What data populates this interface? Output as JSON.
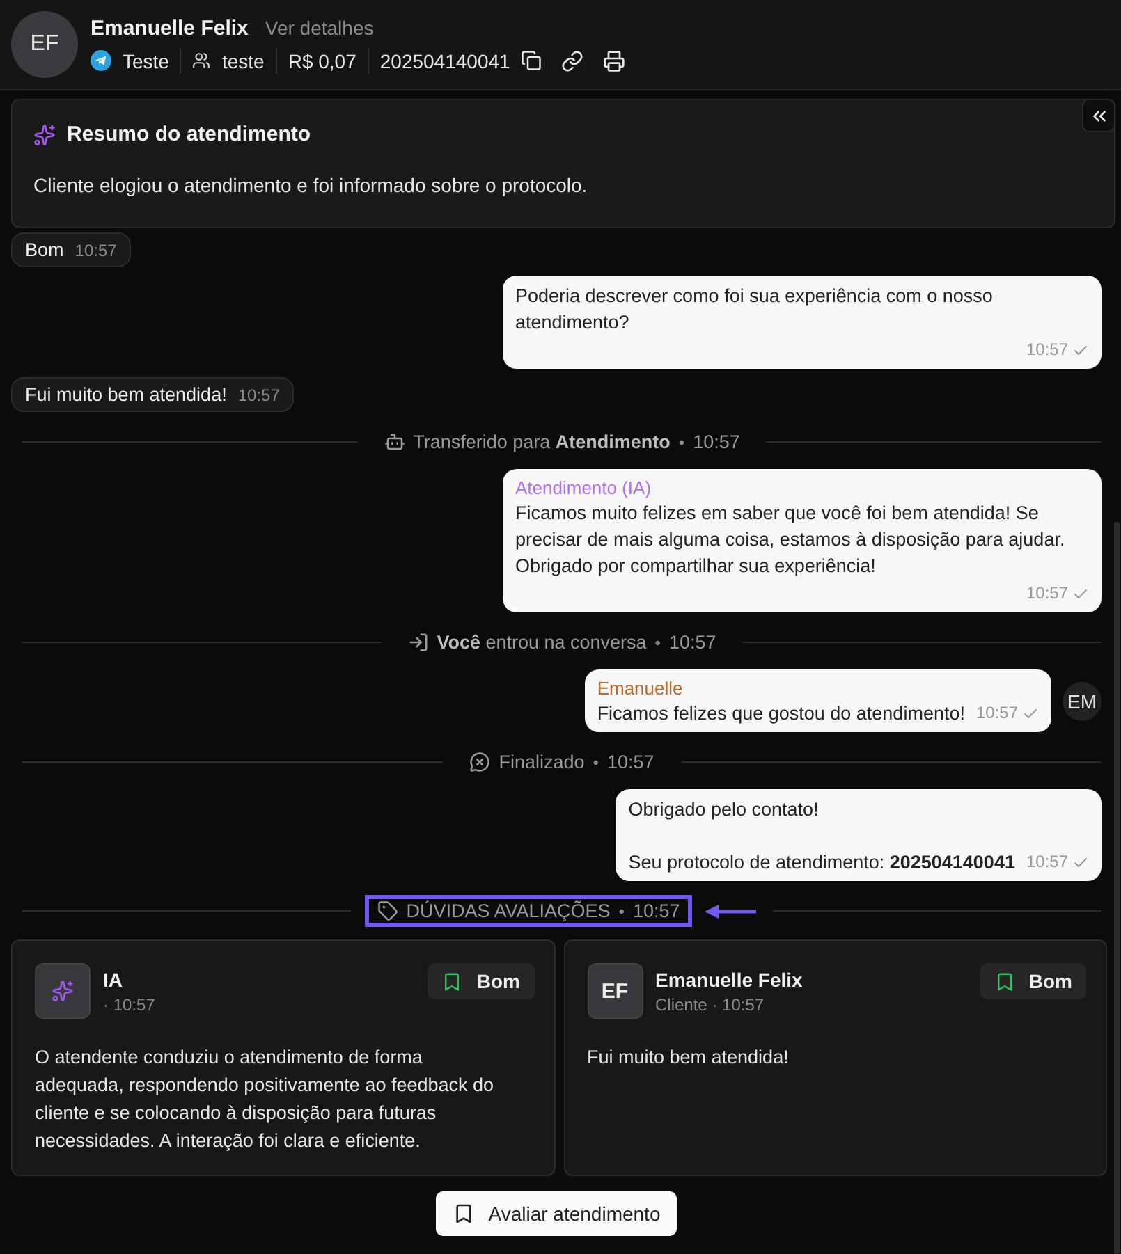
{
  "header": {
    "avatar": "EF",
    "name": "Emanuelle Felix",
    "details_link": "Ver detalhes",
    "channel": "Teste",
    "team": "teste",
    "cost": "R$ 0,07",
    "protocol": "202504140041"
  },
  "summary": {
    "title": "Resumo do atendimento",
    "text": "Cliente elogiou o atendimento e foi informado sobre o protocolo."
  },
  "timeline": [
    {
      "kind": "incoming",
      "text": "Bom",
      "time": "10:57"
    },
    {
      "kind": "outgoing",
      "text": "Poderia descrever como foi sua experiência com o nosso atendimento?",
      "time": "10:57"
    },
    {
      "kind": "incoming",
      "text": "Fui muito bem atendida!",
      "time": "10:57"
    },
    {
      "kind": "transfer",
      "text": "Transferido para **Atendimento**",
      "dot": "•",
      "time": "10:57",
      "highlighted": false
    },
    {
      "kind": "outgoing",
      "sender": "Atendimento (IA)",
      "color": "#b46cf5",
      "text": "Ficamos muito felizes em saber que você foi bem atendida! Se precisar de mais alguma coisa, estamos à disposição para ajudar. Obrigado por compartilhar sua experiência!",
      "time": "10:57"
    },
    {
      "kind": "join",
      "text": "**Você** entrou na conversa",
      "dot": "•",
      "time": "10:57",
      "highlighted": false
    },
    {
      "kind": "outgoing_inline",
      "sender": "Emanuelle",
      "color": "#b9692a",
      "text": "Ficamos felizes que gostou do atendimento!",
      "time": "10:57",
      "avatar": "EM"
    },
    {
      "kind": "finish",
      "text": "Finalizado",
      "dot": "•",
      "time": "10:57",
      "highlighted": false
    },
    {
      "kind": "outgoing_inline",
      "text": "Obrigado pelo contato!\n\nSeu protocolo de atendimento: **202504140041**",
      "time": "10:57"
    },
    {
      "kind": "tag",
      "text": "DÚVIDAS AVALIAÇÕES",
      "dot": "•",
      "time": "10:57",
      "highlighted": true
    }
  ],
  "evaluations": [
    {
      "kind": "ai",
      "name": "IA",
      "meta": "· 10:57",
      "rating": "Bom",
      "text": "O atendente conduziu o atendimento de forma adequada, respondendo positivamente ao feedback do cliente e se colocando à disposição para futuras necessidades. A interação foi clara e eficiente."
    },
    {
      "kind": "initials",
      "avatar": "EF",
      "name": "Emanuelle Felix",
      "meta": "Cliente · 10:57",
      "rating": "Bom",
      "text": "Fui muito bem atendida!"
    }
  ],
  "action_button": "Avaliar atendimento"
}
